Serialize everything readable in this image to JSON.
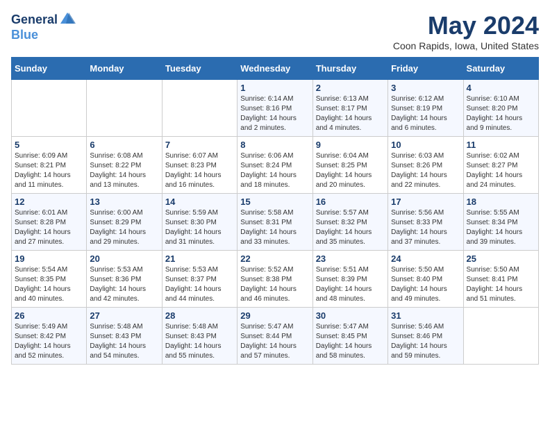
{
  "header": {
    "logo_general": "General",
    "logo_blue": "Blue",
    "month_title": "May 2024",
    "location": "Coon Rapids, Iowa, United States"
  },
  "weekdays": [
    "Sunday",
    "Monday",
    "Tuesday",
    "Wednesday",
    "Thursday",
    "Friday",
    "Saturday"
  ],
  "weeks": [
    [
      {
        "day": "",
        "info": ""
      },
      {
        "day": "",
        "info": ""
      },
      {
        "day": "",
        "info": ""
      },
      {
        "day": "1",
        "info": "Sunrise: 6:14 AM\nSunset: 8:16 PM\nDaylight: 14 hours\nand 2 minutes."
      },
      {
        "day": "2",
        "info": "Sunrise: 6:13 AM\nSunset: 8:17 PM\nDaylight: 14 hours\nand 4 minutes."
      },
      {
        "day": "3",
        "info": "Sunrise: 6:12 AM\nSunset: 8:19 PM\nDaylight: 14 hours\nand 6 minutes."
      },
      {
        "day": "4",
        "info": "Sunrise: 6:10 AM\nSunset: 8:20 PM\nDaylight: 14 hours\nand 9 minutes."
      }
    ],
    [
      {
        "day": "5",
        "info": "Sunrise: 6:09 AM\nSunset: 8:21 PM\nDaylight: 14 hours\nand 11 minutes."
      },
      {
        "day": "6",
        "info": "Sunrise: 6:08 AM\nSunset: 8:22 PM\nDaylight: 14 hours\nand 13 minutes."
      },
      {
        "day": "7",
        "info": "Sunrise: 6:07 AM\nSunset: 8:23 PM\nDaylight: 14 hours\nand 16 minutes."
      },
      {
        "day": "8",
        "info": "Sunrise: 6:06 AM\nSunset: 8:24 PM\nDaylight: 14 hours\nand 18 minutes."
      },
      {
        "day": "9",
        "info": "Sunrise: 6:04 AM\nSunset: 8:25 PM\nDaylight: 14 hours\nand 20 minutes."
      },
      {
        "day": "10",
        "info": "Sunrise: 6:03 AM\nSunset: 8:26 PM\nDaylight: 14 hours\nand 22 minutes."
      },
      {
        "day": "11",
        "info": "Sunrise: 6:02 AM\nSunset: 8:27 PM\nDaylight: 14 hours\nand 24 minutes."
      }
    ],
    [
      {
        "day": "12",
        "info": "Sunrise: 6:01 AM\nSunset: 8:28 PM\nDaylight: 14 hours\nand 27 minutes."
      },
      {
        "day": "13",
        "info": "Sunrise: 6:00 AM\nSunset: 8:29 PM\nDaylight: 14 hours\nand 29 minutes."
      },
      {
        "day": "14",
        "info": "Sunrise: 5:59 AM\nSunset: 8:30 PM\nDaylight: 14 hours\nand 31 minutes."
      },
      {
        "day": "15",
        "info": "Sunrise: 5:58 AM\nSunset: 8:31 PM\nDaylight: 14 hours\nand 33 minutes."
      },
      {
        "day": "16",
        "info": "Sunrise: 5:57 AM\nSunset: 8:32 PM\nDaylight: 14 hours\nand 35 minutes."
      },
      {
        "day": "17",
        "info": "Sunrise: 5:56 AM\nSunset: 8:33 PM\nDaylight: 14 hours\nand 37 minutes."
      },
      {
        "day": "18",
        "info": "Sunrise: 5:55 AM\nSunset: 8:34 PM\nDaylight: 14 hours\nand 39 minutes."
      }
    ],
    [
      {
        "day": "19",
        "info": "Sunrise: 5:54 AM\nSunset: 8:35 PM\nDaylight: 14 hours\nand 40 minutes."
      },
      {
        "day": "20",
        "info": "Sunrise: 5:53 AM\nSunset: 8:36 PM\nDaylight: 14 hours\nand 42 minutes."
      },
      {
        "day": "21",
        "info": "Sunrise: 5:53 AM\nSunset: 8:37 PM\nDaylight: 14 hours\nand 44 minutes."
      },
      {
        "day": "22",
        "info": "Sunrise: 5:52 AM\nSunset: 8:38 PM\nDaylight: 14 hours\nand 46 minutes."
      },
      {
        "day": "23",
        "info": "Sunrise: 5:51 AM\nSunset: 8:39 PM\nDaylight: 14 hours\nand 48 minutes."
      },
      {
        "day": "24",
        "info": "Sunrise: 5:50 AM\nSunset: 8:40 PM\nDaylight: 14 hours\nand 49 minutes."
      },
      {
        "day": "25",
        "info": "Sunrise: 5:50 AM\nSunset: 8:41 PM\nDaylight: 14 hours\nand 51 minutes."
      }
    ],
    [
      {
        "day": "26",
        "info": "Sunrise: 5:49 AM\nSunset: 8:42 PM\nDaylight: 14 hours\nand 52 minutes."
      },
      {
        "day": "27",
        "info": "Sunrise: 5:48 AM\nSunset: 8:43 PM\nDaylight: 14 hours\nand 54 minutes."
      },
      {
        "day": "28",
        "info": "Sunrise: 5:48 AM\nSunset: 8:43 PM\nDaylight: 14 hours\nand 55 minutes."
      },
      {
        "day": "29",
        "info": "Sunrise: 5:47 AM\nSunset: 8:44 PM\nDaylight: 14 hours\nand 57 minutes."
      },
      {
        "day": "30",
        "info": "Sunrise: 5:47 AM\nSunset: 8:45 PM\nDaylight: 14 hours\nand 58 minutes."
      },
      {
        "day": "31",
        "info": "Sunrise: 5:46 AM\nSunset: 8:46 PM\nDaylight: 14 hours\nand 59 minutes."
      },
      {
        "day": "",
        "info": ""
      }
    ]
  ]
}
